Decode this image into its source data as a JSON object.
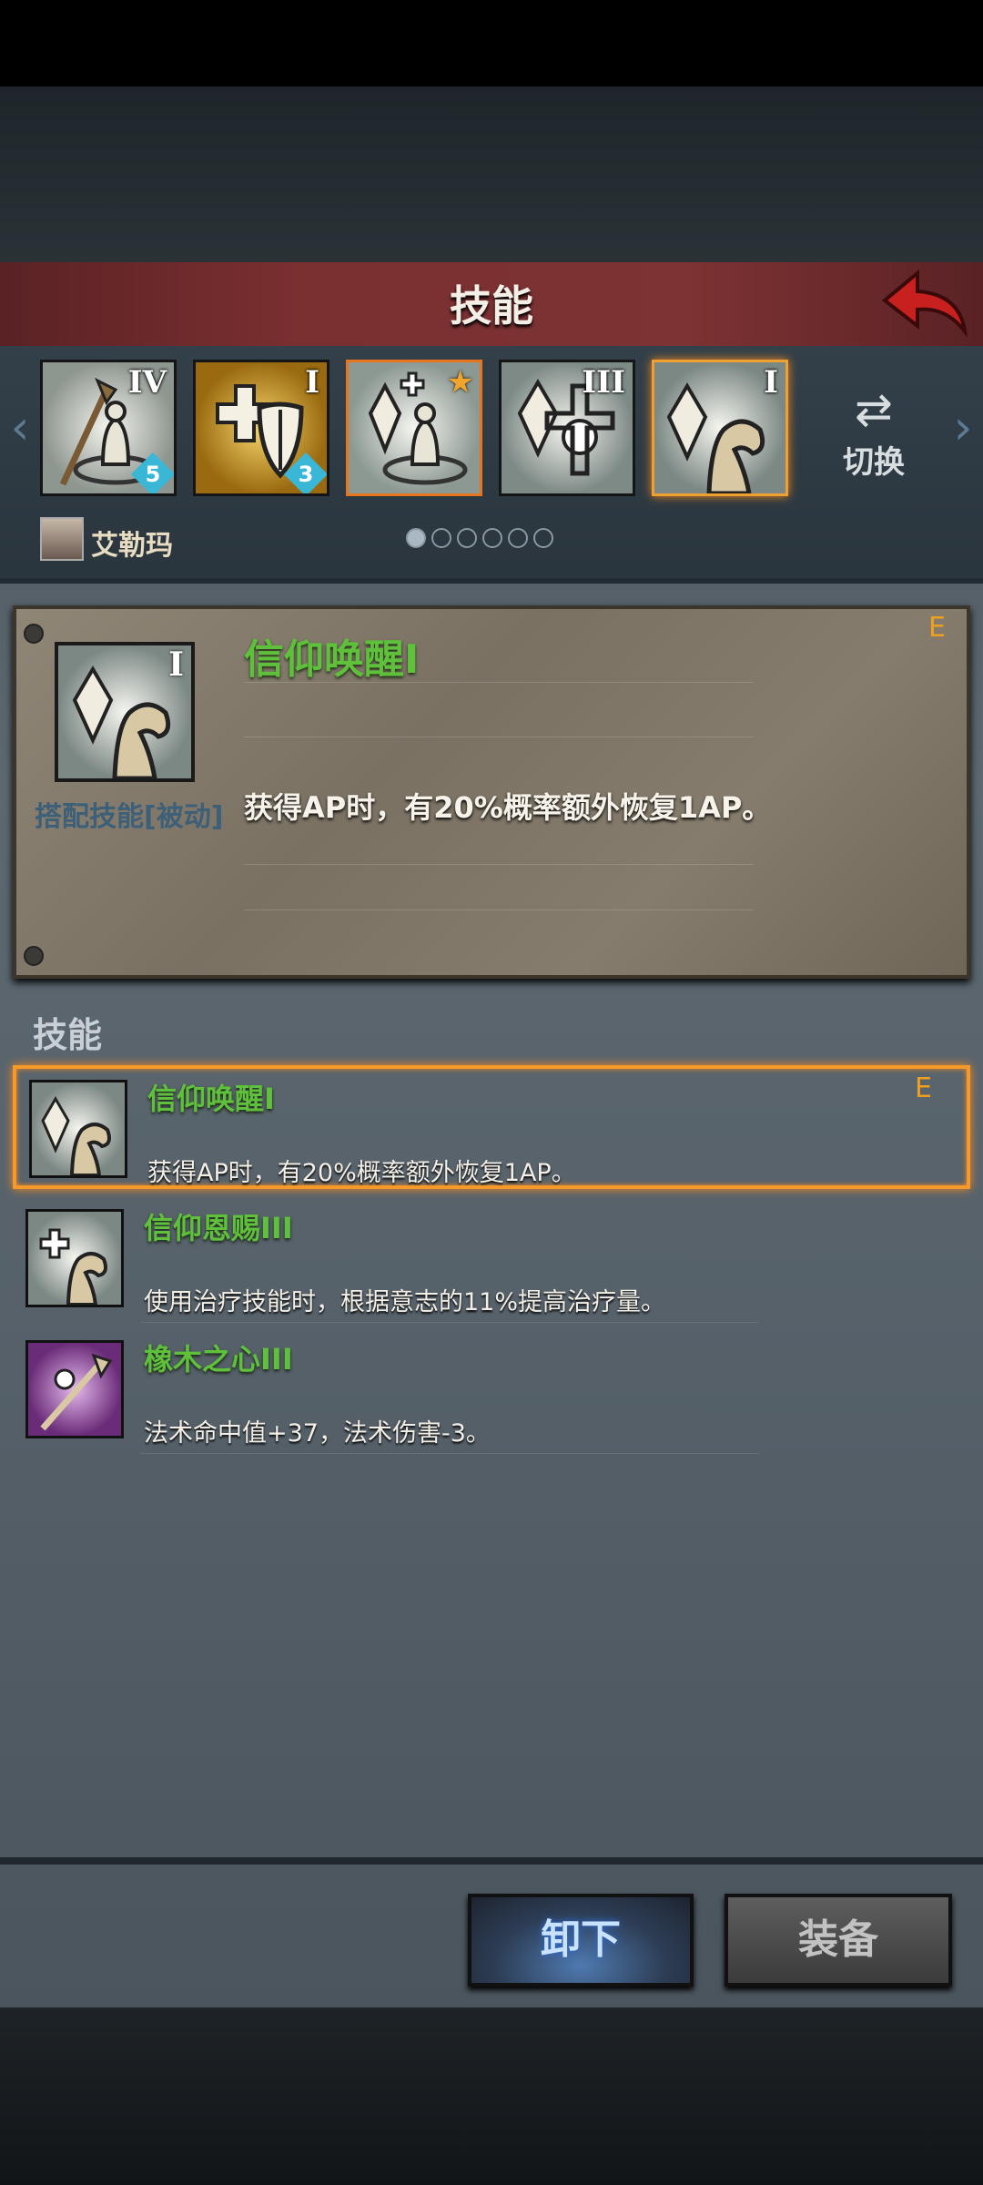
{
  "header": {
    "title": "技能",
    "back_icon": "back-arrow-icon"
  },
  "skill_slots": [
    {
      "roman": "IV",
      "badge": "5",
      "icon": "staff-priest-icon"
    },
    {
      "roman": "I",
      "badge": "3",
      "icon": "holy-shield-icon"
    },
    {
      "roman": "",
      "star": "★",
      "icon": "crystal-priest-icon"
    },
    {
      "roman": "III",
      "badge": "",
      "icon": "crystal-cross-icon"
    },
    {
      "roman": "I",
      "badge": "",
      "icon": "crystal-hand-icon"
    }
  ],
  "switch": {
    "label": "切换",
    "icon": "⇄"
  },
  "character": {
    "name": "艾勒玛"
  },
  "pager": {
    "count": 6,
    "active": 0
  },
  "detail": {
    "name": "信仰唤醒I",
    "roman": "I",
    "grade": "E",
    "type": "搭配技能[被动]",
    "description": "获得AP时，有20%概率额外恢复1AP。"
  },
  "list": {
    "title": "技能",
    "items": [
      {
        "name": "信仰唤醒I",
        "description": "获得AP时，有20%概率额外恢复1AP。",
        "grade": "E",
        "selected": true
      },
      {
        "name": "信仰恩赐III",
        "description": "使用治疗技能时，根据意志的11%提高治疗量。",
        "grade": "",
        "selected": false
      },
      {
        "name": "橡木之心III",
        "description": "法术命中值+37，法术伤害-3。",
        "grade": "",
        "selected": false
      }
    ]
  },
  "buttons": {
    "unequip": "卸下",
    "equip": "装备"
  },
  "colors": {
    "skill_name": "#5fc03b",
    "grade": "#f0a020",
    "selected_border": "#f59a2a"
  }
}
